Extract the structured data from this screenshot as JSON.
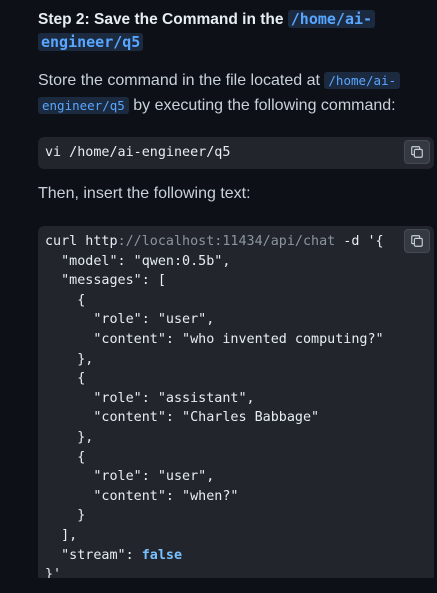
{
  "step": {
    "title_text": "Step 2: Save the Command in the ",
    "title_code": "/home/ai-engineer/q5",
    "title_code_l1": "/home/ai-",
    "title_code_l2": "engineer/q5"
  },
  "instructions": {
    "text_before": "Store the command in the file located at ",
    "path_l1": "/home/ai-",
    "path_l2": "engineer/q5",
    "text_after": " by executing the following command:"
  },
  "command_block": {
    "code": "vi /home/ai-engineer/q5",
    "copy_icon": "copy-icon"
  },
  "then_text": "Then, insert the following text:",
  "curl_block": {
    "lines": [
      "curl http://localhost:11434/api/chat -d '{",
      "  \"model\": \"qwen:0.5b\",",
      "  \"messages\": [",
      "    {",
      "      \"role\": \"user\",",
      "      \"content\": \"who invented computing?\"",
      "    },",
      "    {",
      "      \"role\": \"assistant\",",
      "      \"content\": \"Charles Babbage\"",
      "    },",
      "    {",
      "      \"role\": \"user\",",
      "      \"content\": \"when?\"",
      "    }",
      "  ],",
      "  \"stream\": false",
      "}'"
    ],
    "copy_icon": "copy-icon"
  },
  "colors": {
    "background": "#0d1117",
    "code_bg": "#22262c",
    "inline_code": "#58a6ff",
    "keyword": "#79c0ff"
  }
}
